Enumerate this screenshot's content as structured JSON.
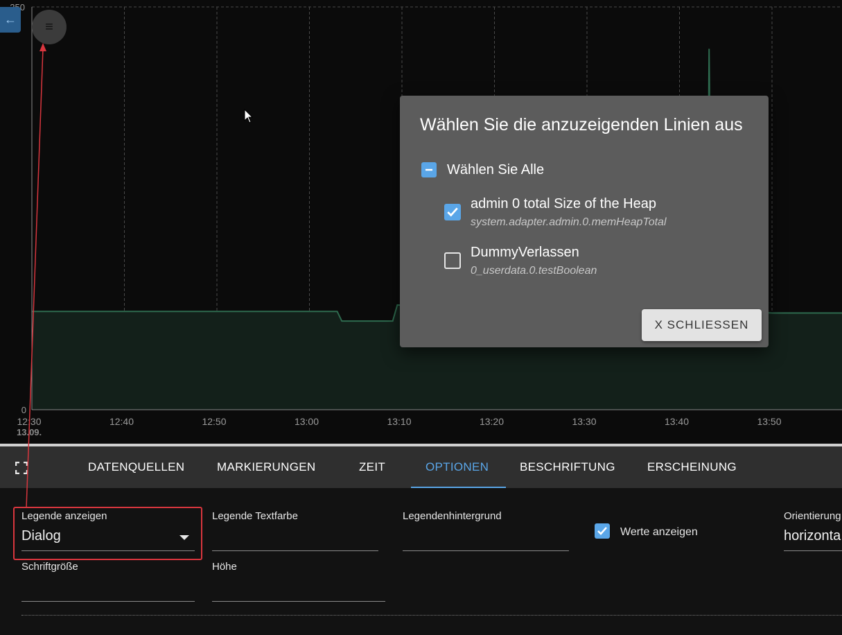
{
  "chart_data": {
    "type": "area",
    "title": "",
    "x_ticks": [
      "12:30",
      "12:40",
      "12:50",
      "13:00",
      "13:10",
      "13:20",
      "13:30",
      "13:40",
      "13:50"
    ],
    "x_date": "13.09.",
    "y_ticks": [
      "0",
      "250"
    ],
    "ylim": [
      0,
      250
    ],
    "grid": true,
    "series": [
      {
        "name": "admin 0 total Size of the Heap",
        "color": "#2e6b4f",
        "x": [
          "12:30",
          "12:40",
          "12:50",
          "13:03",
          "13:03.5",
          "13:09",
          "13:09.5",
          "13:20",
          "13:30",
          "13:43",
          "13:43.2",
          "13:43.5",
          "13:50",
          "13:58",
          "13:58.5",
          "13:59"
        ],
        "values": [
          61,
          61,
          61,
          61,
          55,
          55,
          65,
          62,
          62,
          62,
          224,
          62,
          60,
          60,
          63,
          60
        ]
      }
    ]
  },
  "nav": {
    "back_icon": "arrow-left-icon",
    "menu_icon": "hamburger-icon"
  },
  "tabs": [
    {
      "label": "DATENQUELLEN"
    },
    {
      "label": "MARKIERUNGEN"
    },
    {
      "label": "ZEIT"
    },
    {
      "label": "OPTIONEN"
    },
    {
      "label": "BESCHRIFTUNG"
    },
    {
      "label": "ERSCHEINUNG"
    }
  ],
  "active_tab": "OPTIONEN",
  "options": {
    "legend_show_label": "Legende anzeigen",
    "legend_show_value": "Dialog",
    "legend_text_color_label": "Legende Textfarbe",
    "legend_text_color_value": "",
    "legend_background_label": "Legendenhintergrund",
    "legend_background_value": "",
    "show_values_label": "Werte anzeigen",
    "show_values_checked": true,
    "orientation_label": "Orientierung",
    "orientation_value": "horizonta",
    "font_size_label": "Schriftgröße",
    "font_size_value": "",
    "height_label": "Höhe",
    "height_value": ""
  },
  "dialog": {
    "title": "Wählen Sie die anzuzeigenden Linien aus",
    "select_all_label": "Wählen Sie Alle",
    "items": [
      {
        "name": "admin 0 total Size of the Heap",
        "id": "system.adapter.admin.0.memHeapTotal",
        "checked": true
      },
      {
        "name": "DummyVerlassen",
        "id": "0_userdata.0.testBoolean",
        "checked": false
      }
    ],
    "close_label": "X  SCHLIESSEN"
  },
  "colors": {
    "accent": "#5aa6e8",
    "highlight": "#d9363e",
    "dialog_bg": "#5c5c5c"
  }
}
